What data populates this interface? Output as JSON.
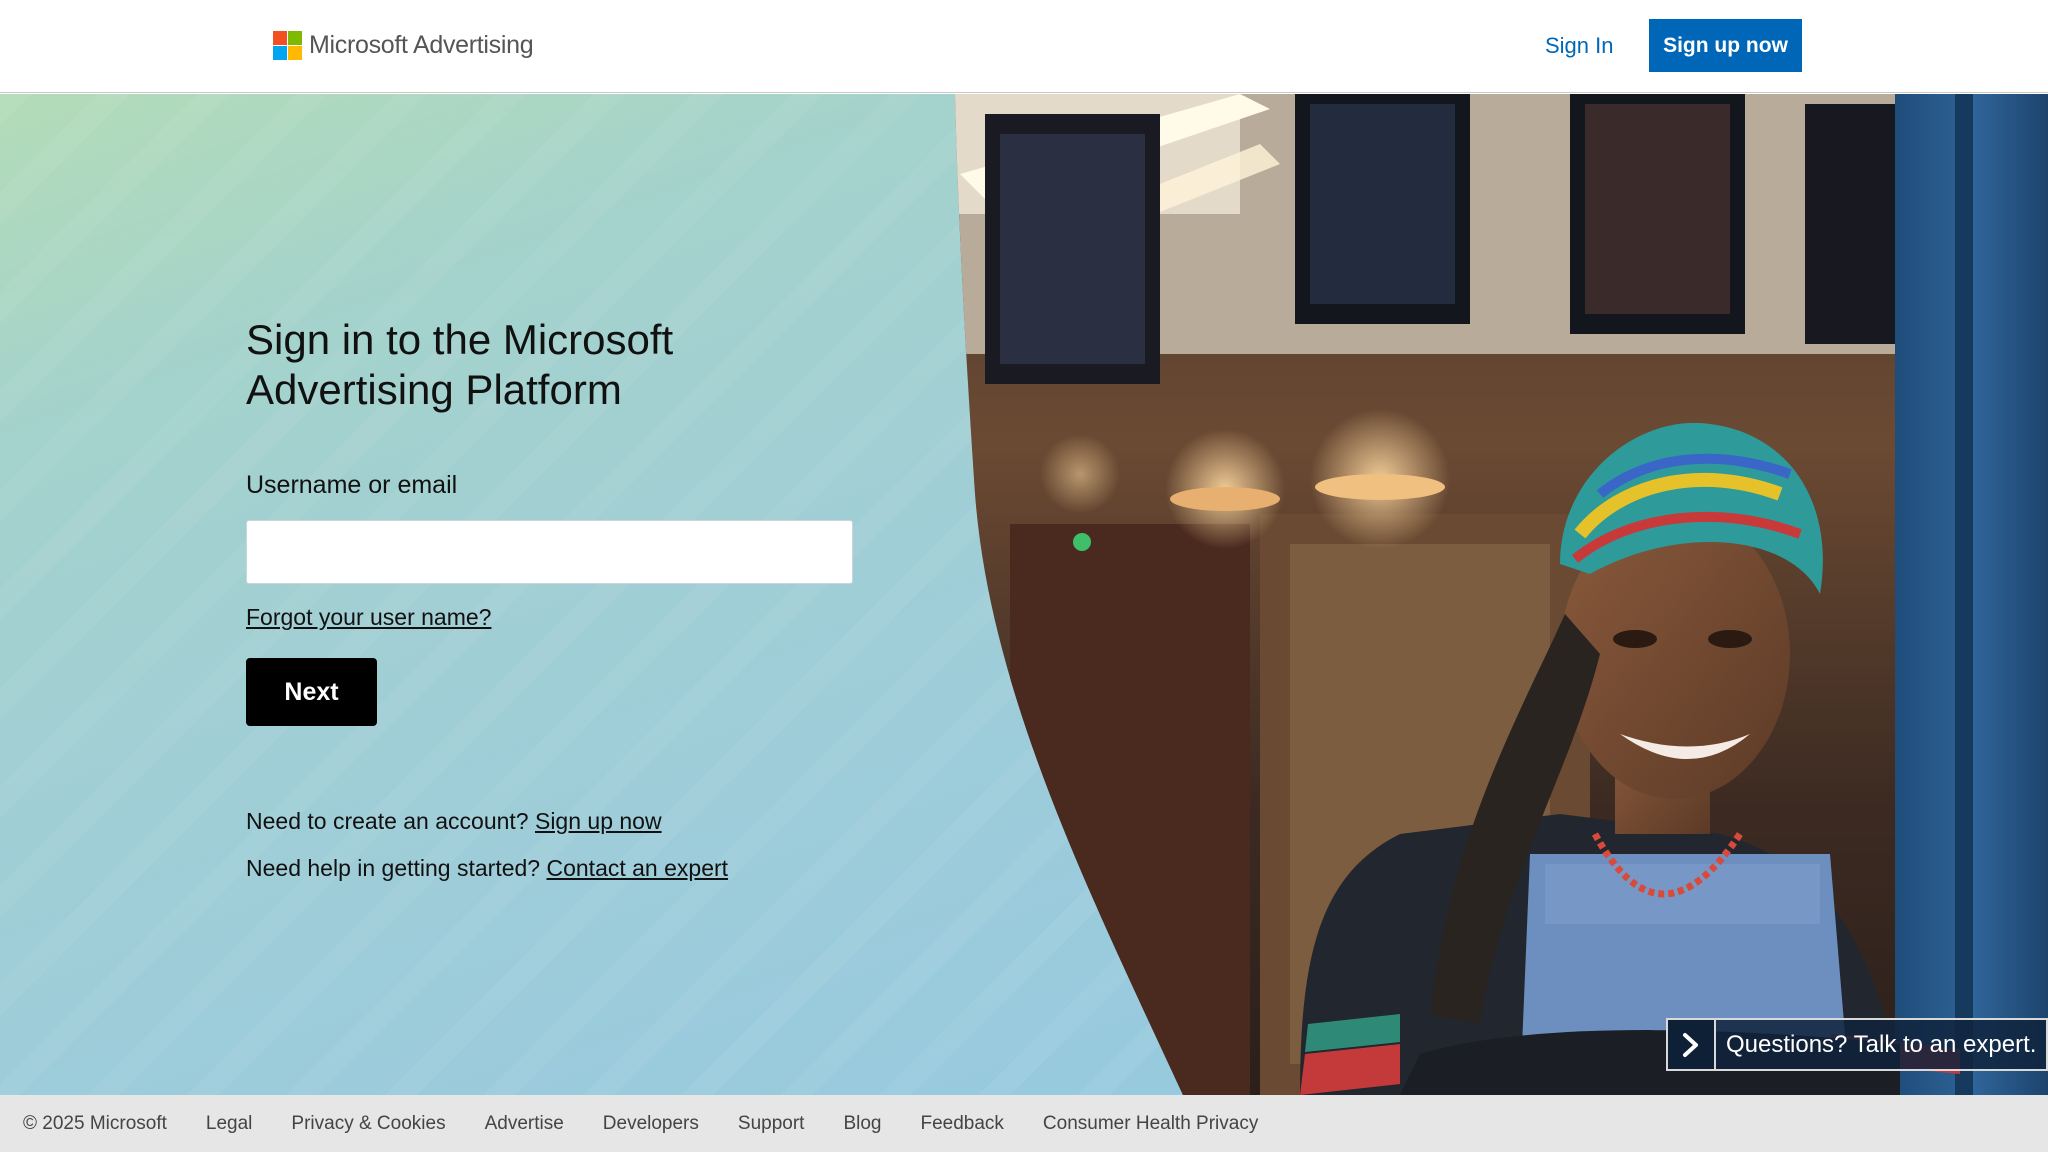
{
  "header": {
    "logo_text": "Microsoft Advertising",
    "signin_label": "Sign In",
    "signup_label": "Sign up now"
  },
  "signin": {
    "title": "Sign in to the Microsoft Advertising Platform",
    "field_label": "Username or email",
    "input_value": "",
    "input_placeholder": "",
    "forgot_label": "Forgot your user name?",
    "next_label": "Next",
    "create_prompt": "Need to create an account?",
    "create_link": "Sign up now",
    "help_prompt": "Need help in getting started?",
    "help_link": "Contact an expert"
  },
  "chat": {
    "label": "Questions? Talk to an expert."
  },
  "footer": {
    "items": [
      "© 2025 Microsoft",
      "Legal",
      "Privacy & Cookies",
      "Advertise",
      "Developers",
      "Support",
      "Blog",
      "Feedback",
      "Consumer Health Privacy"
    ]
  },
  "colors": {
    "accent_blue": "#0067b8",
    "next_button": "#000000",
    "footer_bg": "#e6e6e6"
  }
}
